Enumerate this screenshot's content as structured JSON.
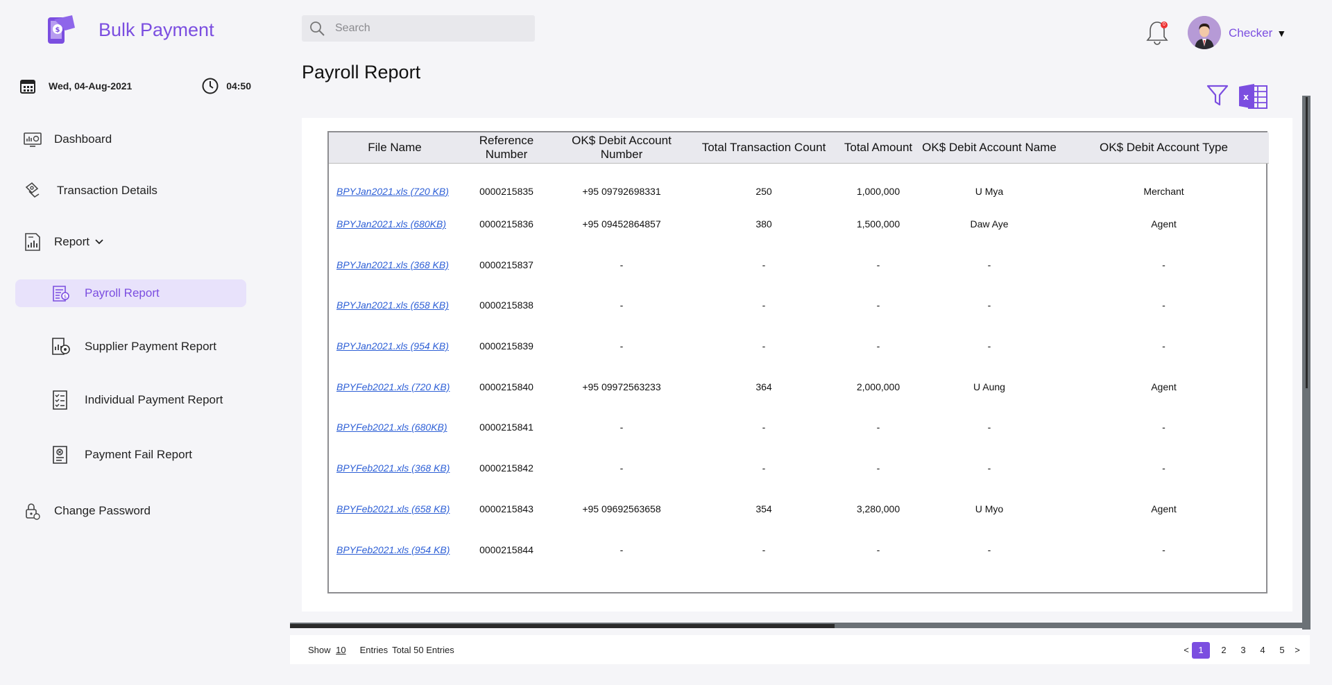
{
  "brand": {
    "title": "Bulk Payment"
  },
  "datetime": {
    "date": "Wed, 04-Aug-2021",
    "time": "04:50"
  },
  "sidebar": {
    "items": [
      {
        "label": "Dashboard",
        "icon": "dashboard-icon"
      },
      {
        "label": "Transaction Details",
        "icon": "transaction-icon"
      },
      {
        "label": "Report",
        "icon": "report-icon"
      },
      {
        "label": "Payroll Report",
        "icon": "payroll-report-icon",
        "active": true
      },
      {
        "label": "Supplier Payment Report",
        "icon": "supplier-report-icon"
      },
      {
        "label": "Individual Payment Report",
        "icon": "individual-report-icon"
      },
      {
        "label": "Payment Fail Report",
        "icon": "fail-report-icon"
      },
      {
        "label": "Change Password",
        "icon": "lock-icon"
      }
    ]
  },
  "header": {
    "search_placeholder": "Search",
    "notification_count": "0",
    "user_name": "Checker",
    "caret": "▼"
  },
  "page": {
    "title": "Payroll Report"
  },
  "colors": {
    "accent": "#7b4ee0",
    "link": "#2d5fd6",
    "badge": "#ee3333"
  },
  "table": {
    "columns": [
      "File Name",
      "Reference Number",
      "OK$ Debit Account Number",
      "Total Transaction Count",
      "Total  Amount",
      "OK$ Debit Account Name",
      "OK$ Debit Account Type"
    ],
    "rows": [
      [
        "BPYJan2021.xls (720 KB)",
        "0000215835",
        "+95 09792698331",
        "250",
        "1,000,000",
        "U Mya",
        "Merchant"
      ],
      [
        "BPYJan2021.xls (680KB)",
        "0000215836",
        "+95 09452864857",
        "380",
        "1,500,000",
        "Daw Aye",
        "Agent"
      ],
      [
        "BPYJan2021.xls (368 KB)",
        "0000215837",
        "-",
        "-",
        "-",
        "-",
        "-"
      ],
      [
        "BPYJan2021.xls (658 KB)",
        "0000215838",
        "-",
        "-",
        "-",
        "-",
        "-"
      ],
      [
        "BPYJan2021.xls (954 KB)",
        "0000215839",
        "-",
        "-",
        "-",
        "-",
        "-"
      ],
      [
        "BPYFeb2021.xls (720 KB)",
        "0000215840",
        "+95 09972563233",
        "364",
        "2,000,000",
        "U Aung",
        "Agent"
      ],
      [
        "BPYFeb2021.xls (680KB)",
        "0000215841",
        "-",
        "-",
        "-",
        "-",
        "-"
      ],
      [
        "BPYFeb2021.xls (368 KB)",
        "0000215842",
        "-",
        "-",
        "-",
        "-",
        "-"
      ],
      [
        "BPYFeb2021.xls (658 KB)",
        "0000215843",
        "+95 09692563658",
        "354",
        "3,280,000",
        "U Myo",
        "Agent"
      ],
      [
        "BPYFeb2021.xls (954 KB)",
        "0000215844",
        "-",
        "-",
        "-",
        "-",
        "-"
      ]
    ]
  },
  "footer": {
    "show_label": "Show",
    "show_value": "10",
    "entries_label": "Entries",
    "total_label": "Total 50 Entries",
    "prev": "<",
    "next": ">",
    "pages": [
      "1",
      "2",
      "3",
      "4",
      "5"
    ],
    "current_page": "1"
  }
}
